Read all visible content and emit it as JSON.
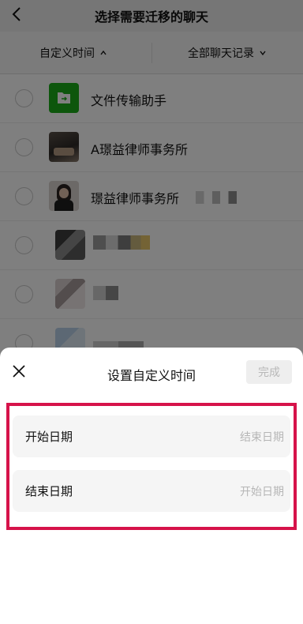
{
  "header": {
    "title": "选择需要迁移的聊天",
    "back_icon": "chevron-left-icon"
  },
  "filter": {
    "time_label": "自定义时间",
    "time_icon": "chevron-up-icon",
    "records_label": "全部聊天记录",
    "records_icon": "chevron-down-icon"
  },
  "chats": [
    {
      "name": "文件传输助手",
      "avatar": "file-transfer-icon"
    },
    {
      "name": "A璟益律师事务所",
      "avatar": "photo-avatar"
    },
    {
      "name": "璟益律师事务所",
      "avatar": "photo-avatar"
    },
    {
      "name": "",
      "avatar": "pixelated-avatar"
    },
    {
      "name": "",
      "avatar": "pixelated-avatar"
    },
    {
      "name": "",
      "avatar": "pixelated-avatar"
    }
  ],
  "sheet": {
    "title": "设置自定义时间",
    "done_label": "完成",
    "close_icon": "close-icon",
    "start": {
      "label": "开始日期",
      "value": "结束日期"
    },
    "end": {
      "label": "结束日期",
      "value": "开始日期"
    }
  },
  "colors": {
    "highlight": "#d6134a",
    "file_transfer": "#1aad19",
    "overlay": "rgba(0,0,0,0.5)"
  }
}
